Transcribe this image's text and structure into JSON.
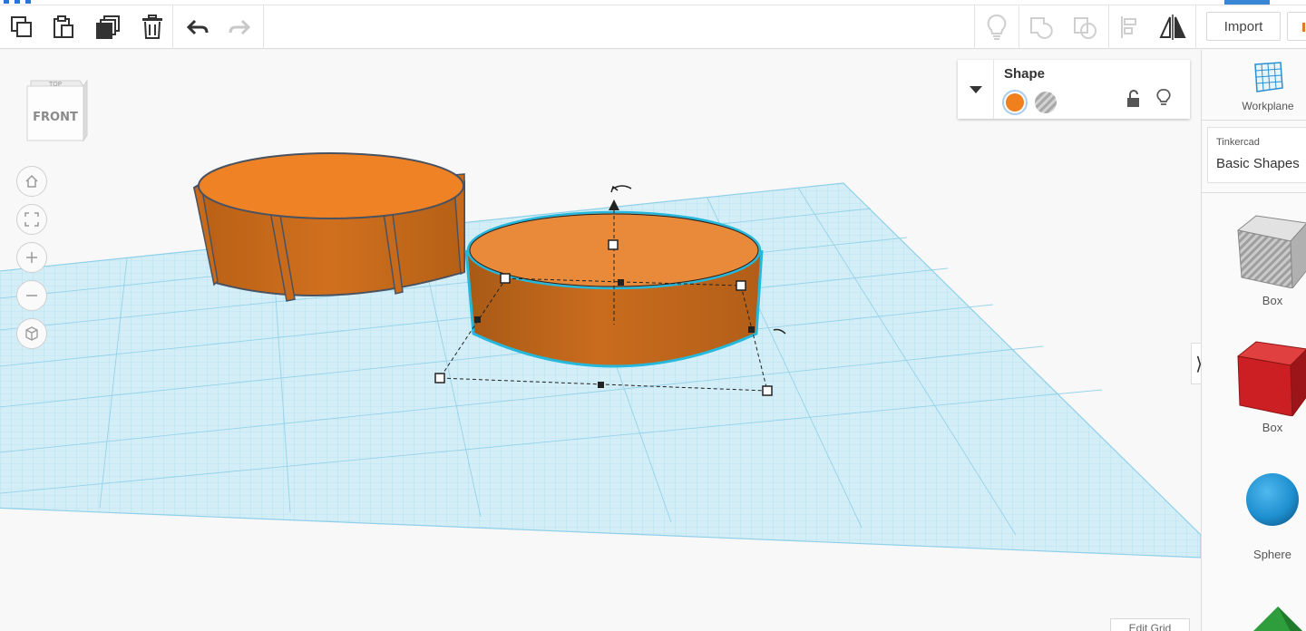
{
  "toolbar": {
    "tools": [
      {
        "id": "copy",
        "icon": "copy-icon"
      },
      {
        "id": "paste",
        "icon": "paste-icon"
      },
      {
        "id": "duplicate",
        "icon": "duplicate-icon"
      },
      {
        "id": "delete",
        "icon": "trash-icon"
      },
      {
        "id": "undo",
        "icon": "undo-icon"
      },
      {
        "id": "redo",
        "icon": "redo-icon"
      }
    ],
    "right_tools": [
      {
        "id": "show-all",
        "icon": "lightbulb-icon"
      },
      {
        "id": "group",
        "icon": "group-icon"
      },
      {
        "id": "ungroup",
        "icon": "ungroup-icon"
      },
      {
        "id": "align",
        "icon": "align-icon"
      },
      {
        "id": "mirror",
        "icon": "mirror-icon"
      }
    ],
    "import_label": "Import"
  },
  "viewcube": {
    "top_label": "TOP",
    "front_label": "FRONT"
  },
  "nav_controls": [
    {
      "id": "home-view",
      "icon": "home-icon"
    },
    {
      "id": "fit-view",
      "icon": "fit-icon"
    },
    {
      "id": "zoom-in",
      "icon": "plus-icon"
    },
    {
      "id": "zoom-out",
      "icon": "minus-icon"
    },
    {
      "id": "ortho-view",
      "icon": "perspective-cube-icon"
    }
  ],
  "shape_panel": {
    "title": "Shape",
    "solid_color": "#f07f1e",
    "hole_label": "Hole",
    "lock_icon": "unlock-icon",
    "visibility_icon": "lightbulb-icon"
  },
  "workplane": {
    "label": "Workplane"
  },
  "library": {
    "brand": "Tinkercad",
    "category": "Basic Shapes"
  },
  "shapes": [
    {
      "label": "Box",
      "kind": "box-hole",
      "color": "#b8b8b8"
    },
    {
      "label": "Box",
      "kind": "box",
      "color": "#d32428"
    },
    {
      "label": "Sphere",
      "kind": "sphere",
      "color": "#1e90d0"
    }
  ],
  "edit_grid_label": "Edit Grid",
  "colors": {
    "accent": "#2a76d2",
    "grid": "#8fd0e8",
    "selection": "#25b8dc",
    "object": "#e07a25"
  }
}
